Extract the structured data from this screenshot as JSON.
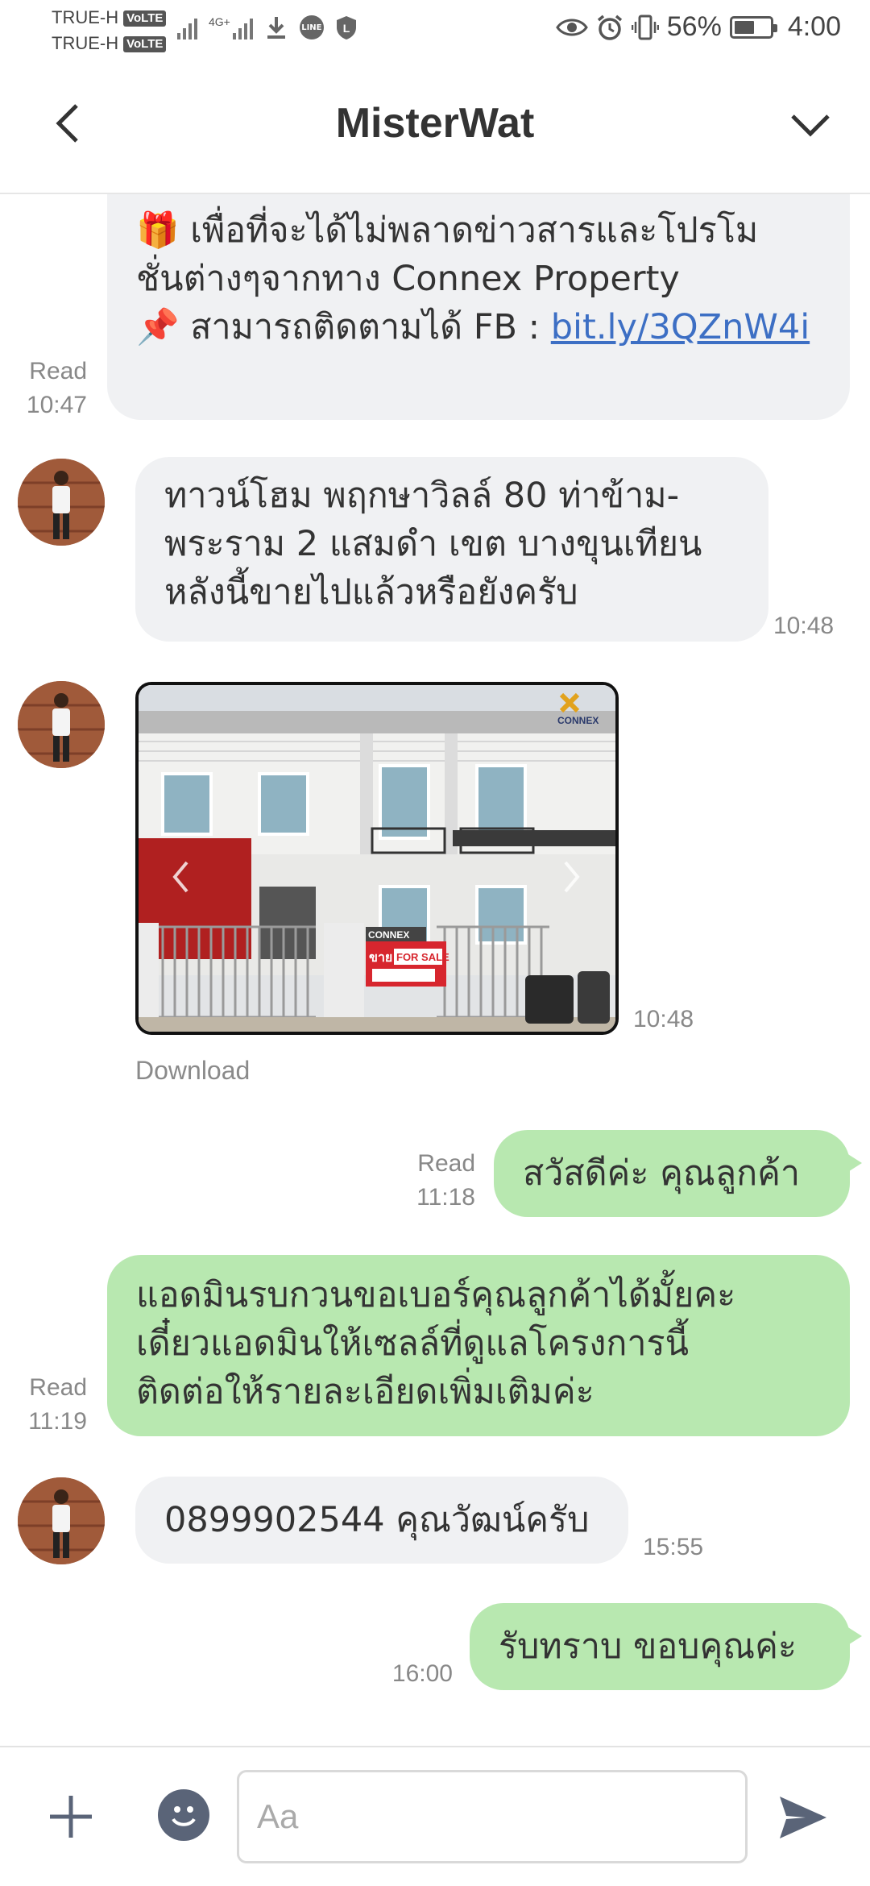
{
  "status_bar": {
    "carrier1": "TRUE-H",
    "carrier2": "TRUE-H",
    "volte": "VoLTE",
    "network": "4G+",
    "battery": "56%",
    "time": "4:00"
  },
  "header": {
    "title": "MisterWat"
  },
  "messages": [
    {
      "direction": "in",
      "lines": [
        "🎁 เพื่อที่จะได้ไม่พลาดข่าวสารและโปรโม",
        "ชั่นต่างๆจากทาง Connex Property",
        "📌 สามารถติดตามได้ FB : "
      ],
      "link": "bit.ly/3QZnW4i",
      "read": "Read",
      "time": "10:47"
    },
    {
      "direction": "in",
      "lines": [
        "ทาวน์โฮม พฤกษาวิลล์ 80 ท่าข้าม-",
        "พระราม 2 แสมดำ เขต บางขุนเทียน",
        "หลังนี้ขายไปแล้วหรือยังครับ"
      ],
      "time": "10:48"
    },
    {
      "direction": "in",
      "type": "image",
      "time": "10:48",
      "download": "Download",
      "image_text": {
        "brand": "CONNEX",
        "sign_brand": "CONNEX",
        "sign_sale_th": "ขาย",
        "sign_sale_en": "FOR SALE"
      }
    },
    {
      "direction": "out",
      "lines": [
        "สวัสดีค่ะ คุณลูกค้า"
      ],
      "read": "Read",
      "time": "11:18"
    },
    {
      "direction": "out",
      "lines": [
        "แอดมินรบกวนขอเบอร์คุณลูกค้าได้มั้ยคะ",
        "เดี๋ยวแอดมินให้เซลล์ที่ดูแลโครงการนี้",
        "ติดต่อให้รายละเอียดเพิ่มเติมค่ะ"
      ],
      "read": "Read",
      "time": "11:19"
    },
    {
      "direction": "in",
      "lines": [
        "0899902544 คุณวัฒน์ครับ"
      ],
      "time": "15:55"
    },
    {
      "direction": "out",
      "lines": [
        "รับทราบ ขอบคุณค่ะ"
      ],
      "time": "16:00"
    }
  ],
  "input": {
    "placeholder": "Aa"
  },
  "colors": {
    "incoming_bubble": "#f0f1f3",
    "outgoing_bubble": "#b8e8b0",
    "link": "#3d6fc4",
    "icon": "#5a6478"
  }
}
